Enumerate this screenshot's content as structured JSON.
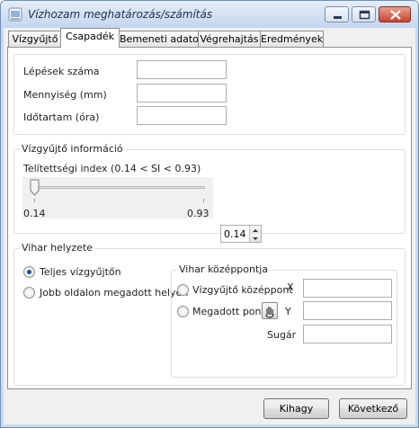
{
  "window": {
    "title": "Vízhozam meghatározás/számítás"
  },
  "tabs": [
    {
      "label": "Vízgyűjtő"
    },
    {
      "label": "Csapadék"
    },
    {
      "label": "Bemeneti adatok"
    },
    {
      "label": "Végrehajtás"
    },
    {
      "label": "Eredmények"
    }
  ],
  "active_tab": "Csapadék",
  "precip": {
    "steps_label": "Lépések száma",
    "steps_value": "",
    "amount_label": "Mennyiség (mm)",
    "amount_value": "",
    "duration_label": "Időtartam (óra)",
    "duration_value": ""
  },
  "catchment_info": {
    "group_label": "Vízgyűjtő információ",
    "saturation_label": "Telítettségi index (0.14 < SI < 0.93)",
    "slider_min_label": "0.14",
    "slider_max_label": "0.93",
    "slider_value": 0.14,
    "spin_value": "0.14"
  },
  "storm": {
    "group_label": "Vihar helyzete",
    "opt_full": "Teljes vízgyűjtőn",
    "opt_right": "Jobb oldalon megadott helyen",
    "selected": "opt_full",
    "center": {
      "group_label": "Vihar középpontja",
      "opt_catchment_center": "Vízgyűjtő középpont",
      "opt_given_point": "Megadott pont",
      "x_label": "X",
      "x_value": "",
      "y_label": "Y",
      "y_value": "",
      "radius_label": "Sugár",
      "radius_value": ""
    }
  },
  "buttons": {
    "skip": "Kihagy",
    "next": "Következő"
  },
  "colors": {
    "titlebar": "#c3d6ef",
    "close_button": "#c7452c",
    "groupbox_border": "#d5dfe5",
    "radio_dot": "#1d4fa0"
  }
}
